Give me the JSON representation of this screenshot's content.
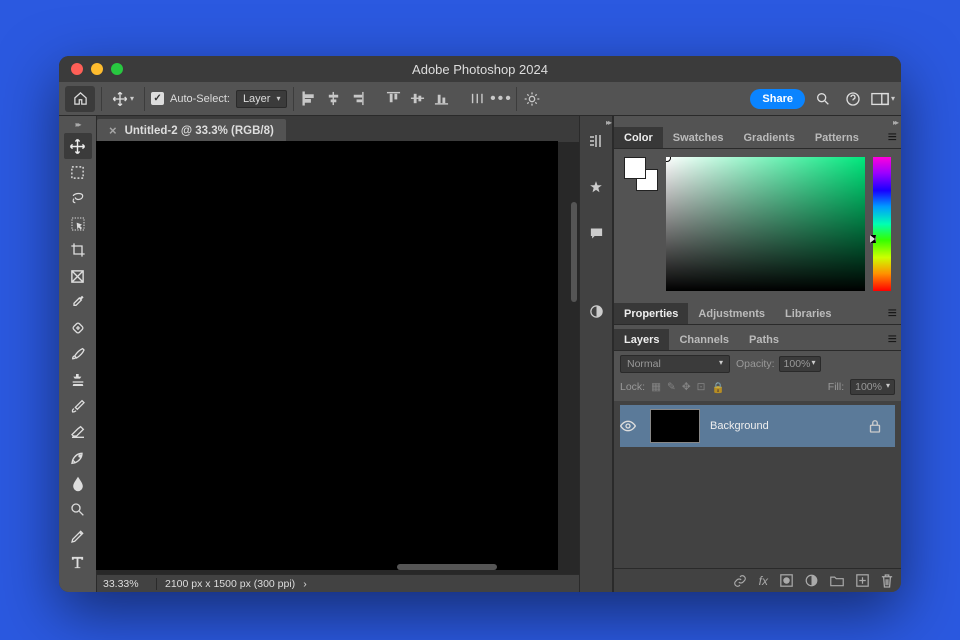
{
  "window": {
    "app_title": "Adobe Photoshop 2024"
  },
  "options_bar": {
    "auto_select_label": "Auto-Select:",
    "auto_select_target": "Layer",
    "show_transform": false,
    "share_label": "Share"
  },
  "document": {
    "tab_label": "Untitled-2 @ 33.3% (RGB/8)",
    "zoom_pct": "33.33%",
    "dimensions": "2100 px x 1500 px (300 ppi)"
  },
  "color_panel": {
    "tabs": [
      "Color",
      "Swatches",
      "Gradients",
      "Patterns"
    ],
    "active_tab": "Color",
    "foreground": "#ffffff",
    "background": "#ffffff"
  },
  "mid_panel": {
    "tabs": [
      "Properties",
      "Adjustments",
      "Libraries"
    ],
    "active_tab": "Properties"
  },
  "layers_panel": {
    "tabs": [
      "Layers",
      "Channels",
      "Paths"
    ],
    "active_tab": "Layers",
    "blend_mode": "Normal",
    "opacity_label": "Opacity:",
    "opacity_value": "100%",
    "lock_label": "Lock:",
    "fill_label": "Fill:",
    "fill_value": "100%",
    "layers": [
      {
        "name": "Background",
        "visible": true,
        "locked": true
      }
    ]
  },
  "tools": [
    "move-tool",
    "marquee-tool",
    "lasso-tool",
    "object-select-tool",
    "crop-tool",
    "frame-tool",
    "eyedropper-tool",
    "spot-heal-tool",
    "brush-tool",
    "clone-stamp-tool",
    "history-brush-tool",
    "eraser-tool",
    "gradient-tool",
    "blur-tool",
    "dodge-tool",
    "pen-tool",
    "type-tool"
  ],
  "ministrip_icons": [
    "bars-icon",
    "star-icon",
    "comment-icon",
    "adjust-icon"
  ]
}
